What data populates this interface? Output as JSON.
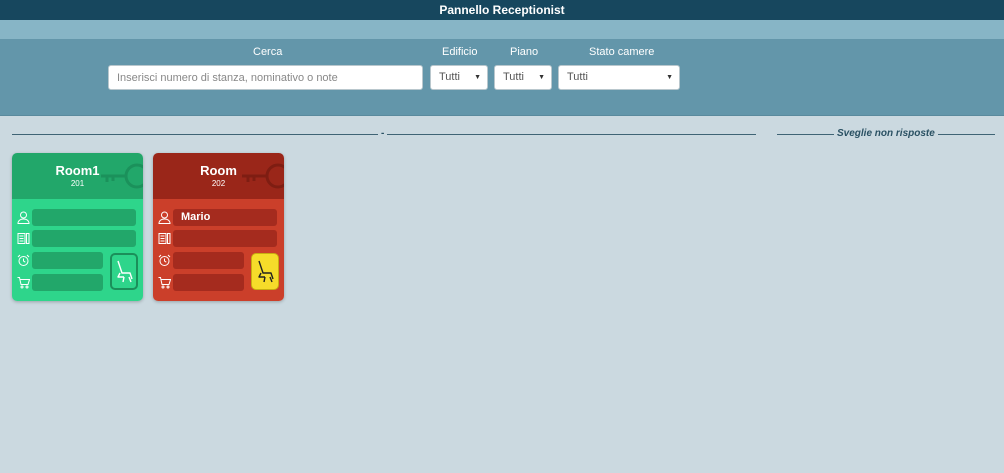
{
  "header": {
    "title": "Pannello Receptionist"
  },
  "filters": {
    "search_label": "Cerca",
    "search_placeholder": "Inserisci numero di stanza, nominativo o note",
    "building_label": "Edificio",
    "building_value": "Tutti",
    "floor_label": "Piano",
    "floor_value": "Tutti",
    "status_label": "Stato camere",
    "status_value": "Tutti"
  },
  "sections": {
    "main_label": "-",
    "wakeups_label": "Sveglie non risposte"
  },
  "rooms": [
    {
      "name": "Room1",
      "number": "201",
      "guest": "",
      "color": "#2ed58b"
    },
    {
      "name": "Room",
      "number": "202",
      "guest": "Mario",
      "color": "#cb3f2a"
    }
  ]
}
